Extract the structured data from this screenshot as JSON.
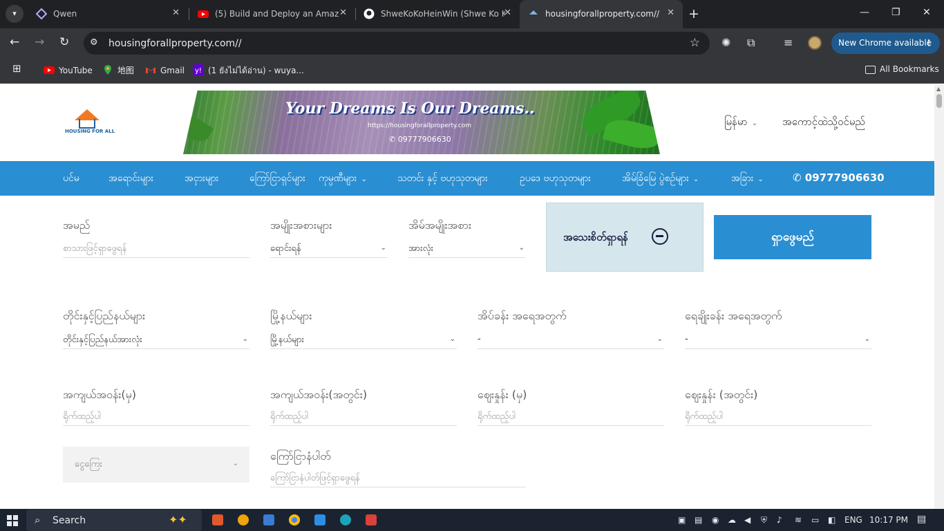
{
  "browser": {
    "tabs": [
      {
        "title": "Qwen",
        "active": false
      },
      {
        "title": "(5) Build and Deploy an Amazin",
        "active": false
      },
      {
        "title": "ShweKoKoHeinWin (Shwe Ko Ko",
        "active": false
      },
      {
        "title": "housingforallproperty.com//",
        "active": true
      }
    ],
    "url": "housingforallproperty.com//",
    "new_chrome_label": "New Chrome available",
    "bookmarks": [
      {
        "label": "YouTube"
      },
      {
        "label": "地图"
      },
      {
        "label": "Gmail"
      },
      {
        "label": "(1 ยังไม่ได้อ่าน) - wuya..."
      }
    ],
    "all_bookmarks_label": "All Bookmarks"
  },
  "site": {
    "logo_text": "HOUSING FOR ALL",
    "banner": {
      "slogan": "Your Dreams Is Our Dreams..",
      "site_url": "https://housingforallproperty.com",
      "phone": "09777906630"
    },
    "language": "မြန်မာ",
    "account": "အကောင့်ထဲသို့ဝင်မည်",
    "nav": [
      {
        "label": "ပင်မ",
        "dropdown": false
      },
      {
        "label": "အရောင်းများ",
        "dropdown": false
      },
      {
        "label": "အငှားများ",
        "dropdown": false
      },
      {
        "label": "ကြော်ငြာရှင်များ",
        "dropdown": false
      },
      {
        "label": "ကုမ္ပဏီများ",
        "dropdown": true
      },
      {
        "label": "သတင်း နှင့် ဗဟုသုတများ",
        "dropdown": false
      },
      {
        "label": "ဥပဒေ ဗဟုသုတများ",
        "dropdown": false
      },
      {
        "label": "အိမ်ခြံမြေ ပွဲစဉ်များ",
        "dropdown": true
      },
      {
        "label": "အခြား",
        "dropdown": true
      }
    ],
    "nav_phone": "09777906630",
    "colors": {
      "nav_bg": "#2a8ed2",
      "button_bg": "#2a8ed2",
      "advanced_bg": "#d5e7ed"
    }
  },
  "search_form": {
    "name": {
      "label": "အမည်",
      "placeholder": "စာသားဖြင့်ရှာဖွေရန်"
    },
    "category": {
      "label": "အမျိုးအစားများ",
      "value": "ရောင်းရန်"
    },
    "property_type": {
      "label": "အိမ်အမျိုးအစား",
      "value": "အားလုံး"
    },
    "advanced_label": "အသေးစိတ်ရှာရန်",
    "search_button": "ရှာဖွေမည်",
    "region": {
      "label": "တိုင်းနှင့်ပြည်နယ်များ",
      "value": "တိုင်းနှင့်ပြည်နယ်အားလုံး"
    },
    "township": {
      "label": "မြို့နယ်များ",
      "value": "မြို့နယ်များ"
    },
    "bedrooms": {
      "label": "အိပ်ခန်း အရေအတွက်",
      "value": "-"
    },
    "bathrooms": {
      "label": "ရေချိုးခန်း အရေအတွက်",
      "value": "-"
    },
    "area_min": {
      "label": "အကျယ်အဝန်း(မှ)",
      "placeholder": "ရိုက်ထည့်ပါ"
    },
    "area_max": {
      "label": "အကျယ်အဝန်း(အတွင်း)",
      "placeholder": "ရိုက်ထည့်ပါ"
    },
    "price_min": {
      "label": "ဈေးနှုန်း (မှ)",
      "placeholder": "ရိုက်ထည့်ပါ"
    },
    "price_max": {
      "label": "ဈေးနှုန်း (အတွင်း)",
      "placeholder": "ရိုက်ထည့်ပါ"
    },
    "currency": {
      "value": "ငွေကြေး"
    },
    "ad_number": {
      "label": "ကြော်ငြာနံပါတ်",
      "placeholder": "ကြော်ငြာနံပါတ်ဖြင့်ရှာဖွေရန်"
    }
  },
  "taskbar": {
    "search_label": "Search",
    "language": "ENG",
    "time": "10:17 PM"
  }
}
